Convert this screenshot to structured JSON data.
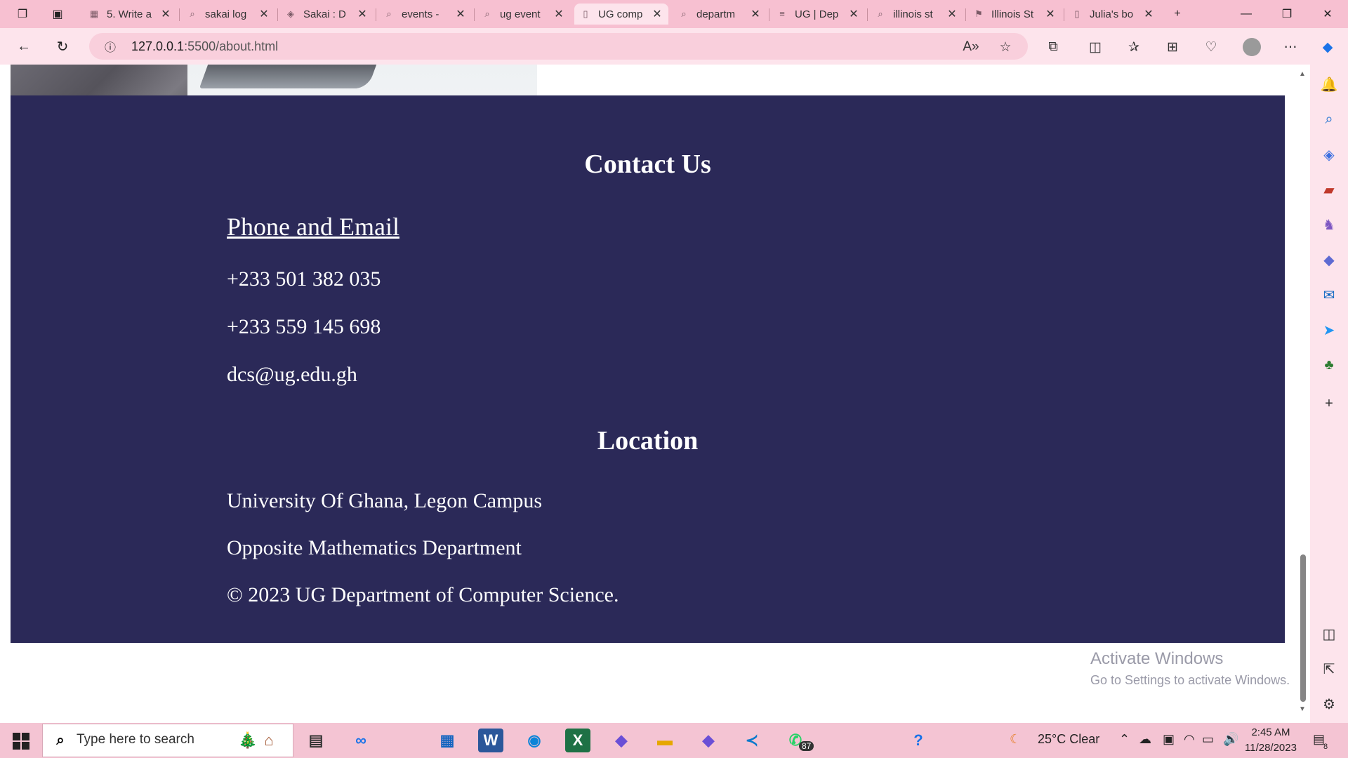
{
  "tabs": [
    {
      "label": "5. Write a",
      "icon": "sakai-icon"
    },
    {
      "label": "sakai log",
      "icon": "search-icon"
    },
    {
      "label": "Sakai : D",
      "icon": "sakai-shield-icon"
    },
    {
      "label": "events -",
      "icon": "search-icon"
    },
    {
      "label": "ug event",
      "icon": "search-icon"
    },
    {
      "label": "UG comp",
      "icon": "page-icon",
      "active": true
    },
    {
      "label": "departm",
      "icon": "search-icon"
    },
    {
      "label": "UG | Dep",
      "icon": "ug-icon"
    },
    {
      "label": "illinois st",
      "icon": "search-icon"
    },
    {
      "label": "Illinois St",
      "icon": "illinois-icon"
    },
    {
      "label": "Julia's bo",
      "icon": "page-icon"
    }
  ],
  "address": {
    "host": "127.0.0.1",
    "path": ":5500/about.html"
  },
  "page": {
    "contact_title": "Contact Us",
    "phone_email_heading": "Phone and Email",
    "phone1": "+233 501 382 035",
    "phone2": "+233 559 145 698",
    "email": "dcs@ug.edu.gh",
    "location_title": "Location",
    "location1": "University Of Ghana, Legon Campus",
    "location2": "Opposite Mathematics Department",
    "copyright": "© 2023 UG Department of Computer Science."
  },
  "watermark": {
    "line1": "Activate Windows",
    "line2": "Go to Settings to activate Windows."
  },
  "taskbar": {
    "search_placeholder": "Type here to search",
    "whatsapp_badge": "87",
    "weather": "25°C  Clear",
    "time": "2:45 AM",
    "date": "11/28/2023",
    "notifications": "8"
  },
  "colors": {
    "footer_bg": "#2b2958",
    "browser_accent": "#f7c0d1"
  }
}
